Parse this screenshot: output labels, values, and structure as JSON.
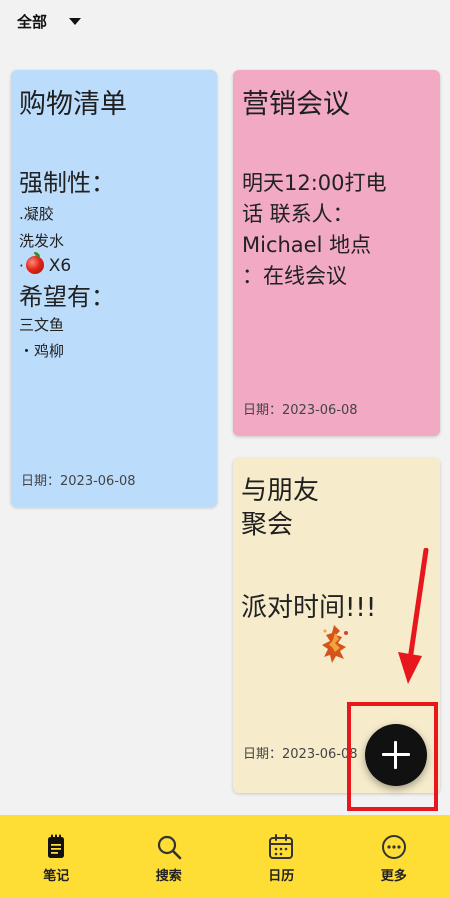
{
  "filter": {
    "label": "全部"
  },
  "notes": [
    {
      "title": "购物清单",
      "lines": [
        "强制性：",
        ".凝胶",
        "洗发水",
        "X6",
        "希望有：",
        "三文鱼",
        "・鸡柳"
      ],
      "date": "日期：2023-06-08",
      "color": "#bcdcfb"
    },
    {
      "title": "营销会议",
      "lines": [
        "明天12:00打电",
        "话 联系人：",
        "Michael 地点",
        "：在线会议"
      ],
      "date": "日期：2023-06-08",
      "color": "#f1a9c4"
    },
    {
      "title_lines": [
        "与朋友",
        "聚会"
      ],
      "lines": [
        "派对时间!!!"
      ],
      "date": "日期：2023-06-08",
      "color": "#f6ebcb"
    }
  ],
  "nav": [
    {
      "label": "笔记",
      "icon": "notes-icon"
    },
    {
      "label": "搜索",
      "icon": "search-icon"
    },
    {
      "label": "日历",
      "icon": "calendar-icon"
    },
    {
      "label": "更多",
      "icon": "more-icon"
    }
  ],
  "colors": {
    "nav_bg": "#fedd35",
    "fab": "#111111",
    "highlight": "#e8161d"
  }
}
